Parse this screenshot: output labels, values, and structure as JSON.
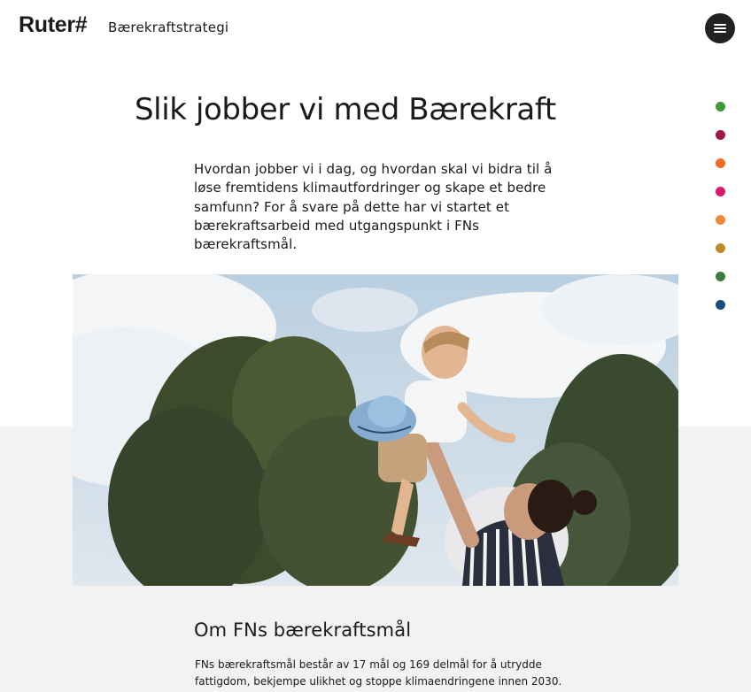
{
  "header": {
    "logo_text": "Ruter#",
    "site_title": "Bærekraftstrategi",
    "menu_icon": "hamburger-menu-icon"
  },
  "side_nav": {
    "dots": [
      {
        "color": "#3d9a3a"
      },
      {
        "color": "#a01848"
      },
      {
        "color": "#f16a22"
      },
      {
        "color": "#d8196c"
      },
      {
        "color": "#f0893a"
      },
      {
        "color": "#c18a28"
      },
      {
        "color": "#3c7d3e"
      },
      {
        "color": "#174e7c"
      }
    ]
  },
  "main": {
    "title": "Slik jobber vi med Bærekraft",
    "intro": "Hvordan jobber vi i dag, og hvordan skal vi bidra til å løse fremtidens klimautfordringer og skape et bedre samfunn? For å svare på dette har vi startet et bærekraftsarbeid med utgangspunkt i FNs bærekraftsmål."
  },
  "section": {
    "heading": "Om FNs bærekraftsmål",
    "body": "FNs bærekraftsmål består av 17 mål og 169 delmål for å utrydde fattigdom, bekjempe ulikhet og stoppe klimaendringene innen 2030."
  }
}
